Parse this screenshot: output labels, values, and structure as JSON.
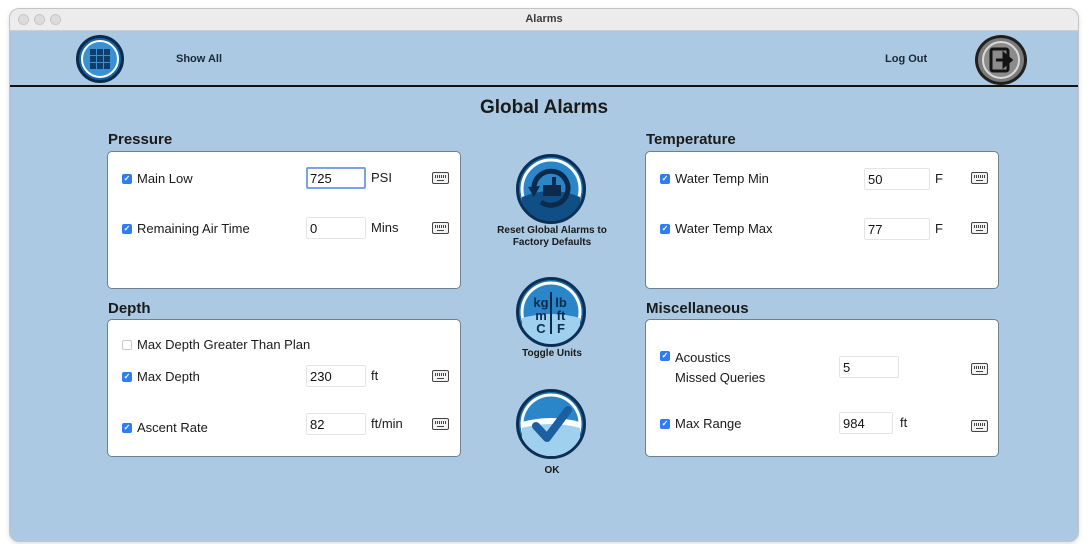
{
  "window": {
    "title": "Alarms"
  },
  "header": {
    "show_all_label": "Show All",
    "logout_label": "Log Out"
  },
  "page_title": "Global Alarms",
  "pressure": {
    "title": "Pressure",
    "rows": [
      {
        "label": "Main Low",
        "checked": true,
        "value": "725",
        "unit": "PSI"
      },
      {
        "label": "Remaining Air Time",
        "checked": true,
        "value": "0",
        "unit": "Mins"
      }
    ]
  },
  "depth": {
    "title": "Depth",
    "rows": [
      {
        "label": "Max Depth Greater Than Plan",
        "checked": false
      },
      {
        "label": "Max Depth",
        "checked": true,
        "value": "230",
        "unit": "ft"
      },
      {
        "label": "Ascent Rate",
        "checked": true,
        "value": "82",
        "unit": "ft/min"
      }
    ]
  },
  "temperature": {
    "title": "Temperature",
    "rows": [
      {
        "label": "Water Temp Min",
        "checked": true,
        "value": "50",
        "unit": "F"
      },
      {
        "label": "Water Temp Max",
        "checked": true,
        "value": "77",
        "unit": "F"
      }
    ]
  },
  "misc": {
    "title": "Miscellaneous",
    "rows": [
      {
        "label_line1": "Acoustics",
        "label_line2": "Missed Queries",
        "checked": true,
        "value": "5",
        "unit": ""
      },
      {
        "label": "Max Range",
        "checked": true,
        "value": "984",
        "unit": "ft"
      }
    ]
  },
  "center": {
    "reset_label_line1": "Reset Global Alarms to",
    "reset_label_line2": "Factory Defaults",
    "toggle_label": "Toggle Units",
    "ok_label": "OK",
    "units_icon": {
      "kg": "kg",
      "lb": "lb",
      "m": "m",
      "ft": "ft",
      "c": "C",
      "f": "F"
    }
  },
  "colors": {
    "background": "#abc9e2",
    "accent": "#1b6fb0",
    "checkbox": "#2f7df4"
  }
}
